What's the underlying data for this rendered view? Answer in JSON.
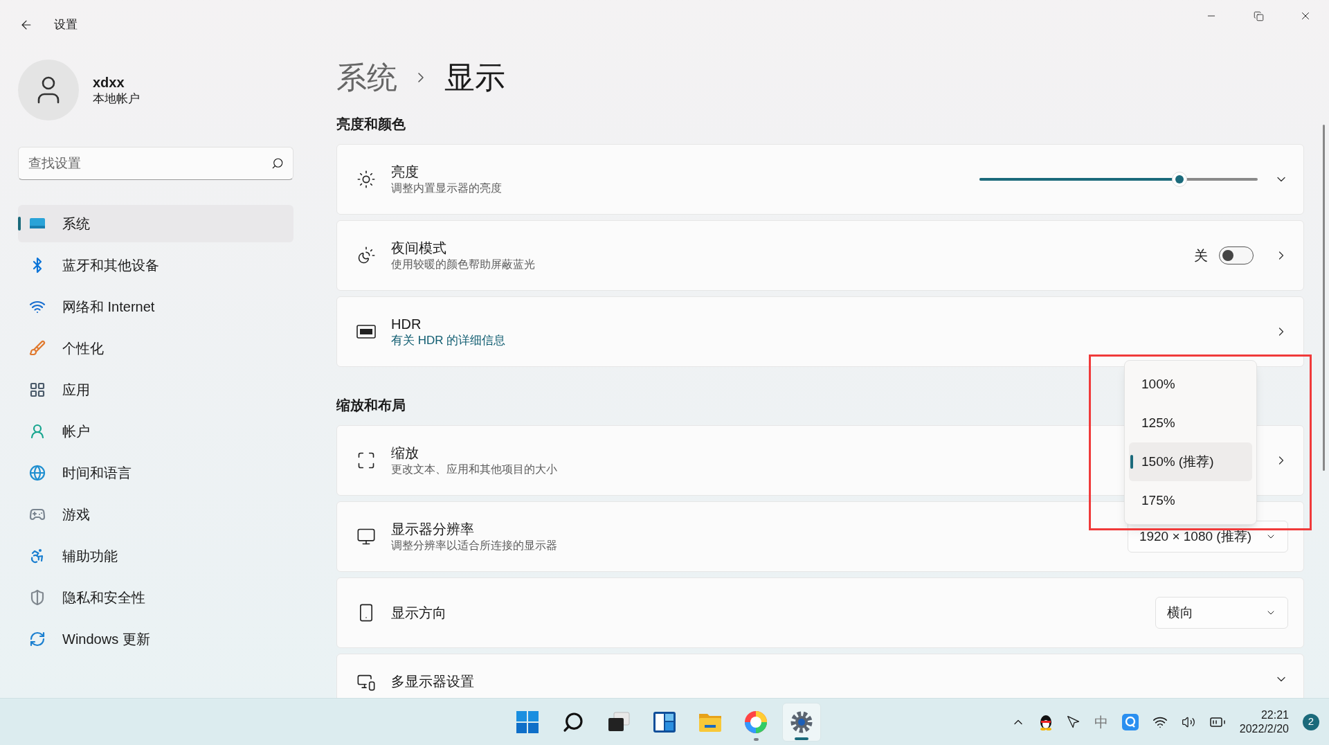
{
  "window": {
    "title": "设置"
  },
  "user": {
    "name": "xdxx",
    "account_type": "本地帐户"
  },
  "search": {
    "placeholder": "查找设置"
  },
  "sidebar": {
    "items": [
      {
        "label": "系统",
        "selected": true
      },
      {
        "label": "蓝牙和其他设备",
        "selected": false
      },
      {
        "label": "网络和 Internet",
        "selected": false
      },
      {
        "label": "个性化",
        "selected": false
      },
      {
        "label": "应用",
        "selected": false
      },
      {
        "label": "帐户",
        "selected": false
      },
      {
        "label": "时间和语言",
        "selected": false
      },
      {
        "label": "游戏",
        "selected": false
      },
      {
        "label": "辅助功能",
        "selected": false
      },
      {
        "label": "隐私和安全性",
        "selected": false
      },
      {
        "label": "Windows 更新",
        "selected": false
      }
    ]
  },
  "breadcrumb": {
    "parent": "系统",
    "current": "显示"
  },
  "sections": [
    {
      "title": "亮度和颜色",
      "cards": [
        {
          "kind": "slider",
          "title": "亮度",
          "subtitle": "调整内置显示器的亮度",
          "level": 0.72
        },
        {
          "kind": "toggle",
          "title": "夜间模式",
          "subtitle": "使用较暖的颜色帮助屏蔽蓝光",
          "state_label": "关",
          "on": false
        },
        {
          "kind": "link",
          "title": "HDR",
          "link": "有关 HDR 的详细信息"
        }
      ]
    },
    {
      "title": "缩放和布局",
      "cards": [
        {
          "kind": "menu",
          "title": "缩放",
          "subtitle": "更改文本、应用和其他项目的大小",
          "options": [
            {
              "label": "100%",
              "selected": false
            },
            {
              "label": "125%",
              "selected": false
            },
            {
              "label": "150% (推荐)",
              "selected": true
            },
            {
              "label": "175%",
              "selected": false
            }
          ]
        },
        {
          "kind": "dropdown",
          "title": "显示器分辨率",
          "subtitle": "调整分辨率以适合所连接的显示器",
          "value": "1920 × 1080 (推荐)"
        },
        {
          "kind": "dropdown",
          "title": "显示方向",
          "value": "横向"
        },
        {
          "kind": "expand",
          "title": "多显示器设置"
        }
      ]
    }
  ],
  "taskbar": {
    "apps": [
      {
        "running": false,
        "selected": false
      },
      {
        "running": true,
        "selected": false
      },
      {
        "running": true,
        "selected": true
      }
    ],
    "ime": "中",
    "time": "22:21",
    "date": "2022/2/20",
    "notifications": "2"
  }
}
